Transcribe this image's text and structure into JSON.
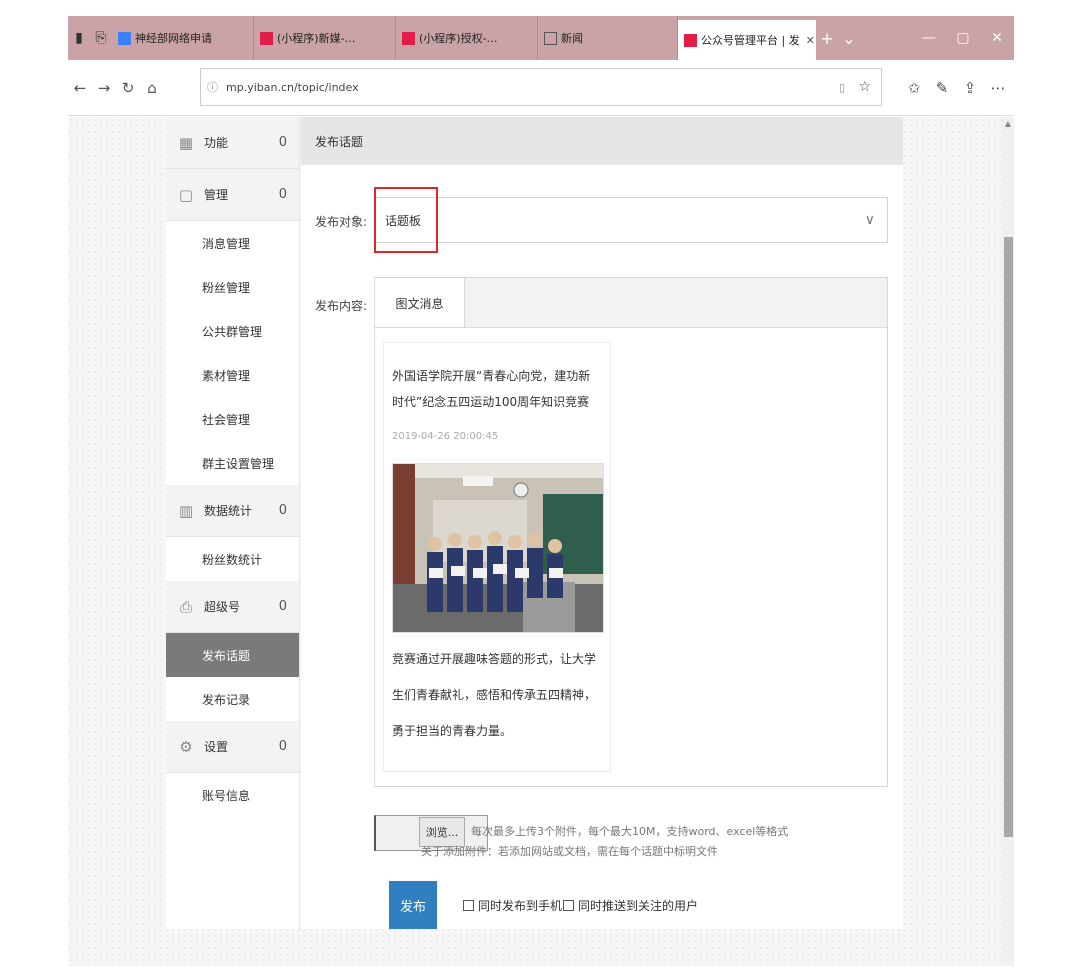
{
  "browser": {
    "tabs": [
      {
        "label": "神经部网络申请",
        "color": "#3b82f6"
      },
      {
        "label": "(小程序)新媒-…",
        "color": "#e11d48"
      },
      {
        "label": "(小程序)授权-…",
        "color": "#e11d48"
      },
      {
        "label": "新闻"
      },
      {
        "label": "公众号管理平台 | 发",
        "color": "#e11d48",
        "active": true
      }
    ],
    "tab_close": "✕",
    "new_tab": "+",
    "url": "mp.yiban.cn/topic/index",
    "window_controls": [
      "—",
      "▢",
      "✕"
    ]
  },
  "sidebar": {
    "sections": [
      {
        "icon": "grid-icon",
        "label": "功能",
        "count": "0"
      },
      {
        "icon": "doc-icon",
        "label": "管理",
        "count": "0",
        "items": [
          {
            "label": "消息管理"
          },
          {
            "label": "粉丝管理"
          },
          {
            "label": "公共群管理"
          },
          {
            "label": "素材管理"
          },
          {
            "label": "社会管理"
          },
          {
            "label": "群主设置管理"
          }
        ]
      },
      {
        "icon": "chart-icon",
        "label": "数据统计",
        "count": "0",
        "items": [
          {
            "label": "粉丝数统计"
          }
        ]
      },
      {
        "icon": "print-icon",
        "label": "超级号",
        "count": "0",
        "items": [
          {
            "label": "发布话题",
            "active": true
          },
          {
            "label": "发布记录"
          }
        ]
      },
      {
        "icon": "gear-icon",
        "label": "设置",
        "count": "0",
        "items": [
          {
            "label": "账号信息"
          }
        ]
      }
    ]
  },
  "main": {
    "header": "发布话题",
    "target_label": "发布对象:",
    "target_value": "话题板",
    "content_label": "发布内容:",
    "tab_label": "图文消息",
    "card": {
      "title": "外国语学院开展“青春心向党，建功新时代”纪念五四运动100周年知识竞赛",
      "date": "2019-04-26 20:00:45",
      "desc": "竞赛通过开展趣味答题的形式，让大学生们青春献礼，感悟和传承五四精神，勇于担当的青春力量。"
    },
    "file_button": "浏览...",
    "file_note1": "每次最多上传3个附件，每个最大10M，支持word、excel等格式",
    "file_note2": "关于添加附件：若添加网站或文档，需在每个话题中标明文件",
    "publish_label": "发布",
    "options": [
      "同时发布到手机",
      "同时推送到关注的用户"
    ]
  }
}
